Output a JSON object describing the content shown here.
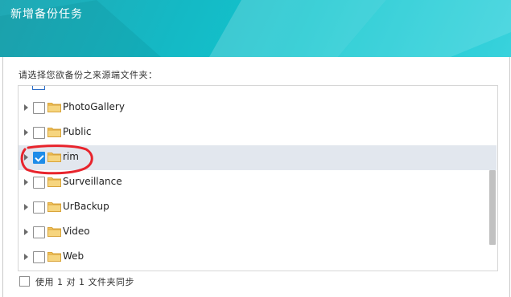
{
  "dialog": {
    "title": "新增备份任务",
    "prompt": "请选择您欲备份之来源端文件夹：",
    "sync_option_label": "使用 1 对 1 文件夹同步"
  },
  "folders": [
    {
      "name": "PhotoGallery",
      "checked": false,
      "selected": false
    },
    {
      "name": "Public",
      "checked": false,
      "selected": false
    },
    {
      "name": "rim",
      "checked": true,
      "selected": true
    },
    {
      "name": "Surveillance",
      "checked": false,
      "selected": false
    },
    {
      "name": "UrBackup",
      "checked": false,
      "selected": false
    },
    {
      "name": "Video",
      "checked": false,
      "selected": false
    },
    {
      "name": "Web",
      "checked": false,
      "selected": false
    }
  ],
  "sync_option_checked": false,
  "colors": {
    "header_gradient_start": "#21a8b4",
    "header_gradient_end": "#39d2dc",
    "checkbox_checked": "#1e8ce8",
    "selected_row": "#e2e7ee",
    "annotation": "#e8242c",
    "folder": "#f2c35a"
  },
  "icons": {
    "expand": "caret-right-icon",
    "folder": "folder-icon"
  }
}
